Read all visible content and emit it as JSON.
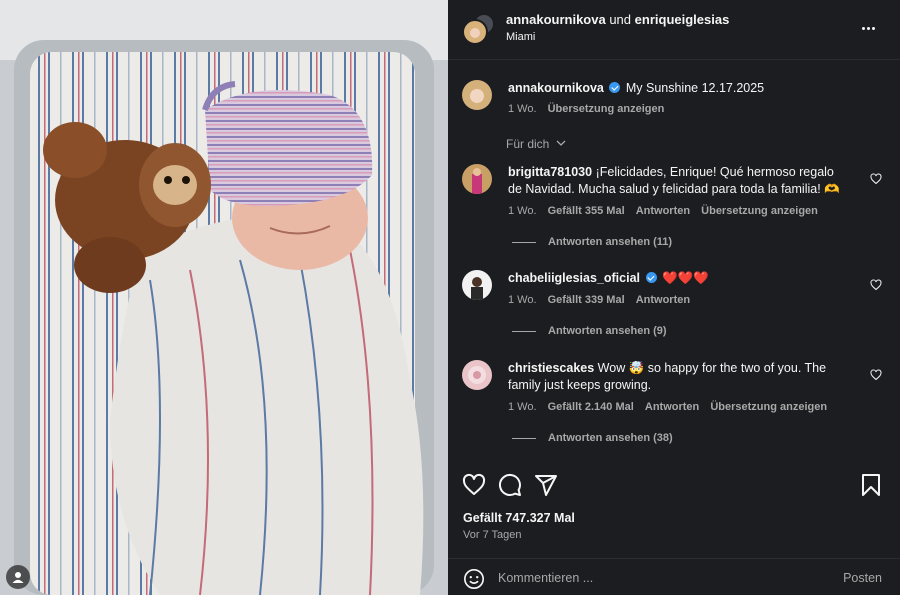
{
  "header": {
    "user1": "annakournikova",
    "conjunction": "und",
    "user2": "enriqueiglesias",
    "location": "Miami"
  },
  "caption": {
    "username": "annakournikova",
    "text": "My Sunshine 12.17.2025",
    "time": "1 Wo.",
    "translate": "Übersetzung anzeigen"
  },
  "filter_label": "Für dich",
  "comments": [
    {
      "username": "brigitta781030",
      "text": "¡Felicidades, Enrique! Qué hermoso regalo de Navidad. Mucha salud y felicidad para toda la familia! 🫶",
      "time": "1 Wo.",
      "likes": "Gefällt 355 Mal",
      "reply": "Antworten",
      "translate": "Übersetzung anzeigen",
      "view_replies": "Antworten ansehen (11)"
    },
    {
      "username": "chabeliiglesias_oficial",
      "text": "❤️❤️❤️",
      "time": "1 Wo.",
      "likes": "Gefällt 339 Mal",
      "reply": "Antworten",
      "view_replies": "Antworten ansehen (9)"
    },
    {
      "username": "christiescakes",
      "text": "Wow 🤯 so happy for the two of you. The family just keeps growing.",
      "time": "1 Wo.",
      "likes": "Gefällt 2.140 Mal",
      "reply": "Antworten",
      "translate": "Übersetzung anzeigen",
      "view_replies": "Antworten ansehen (38)"
    }
  ],
  "post": {
    "likes": "Gefällt 747.327 Mal",
    "date": "Vor 7 Tagen"
  },
  "composer": {
    "placeholder": "Kommentieren ...",
    "post_label": "Posten"
  },
  "colors": {
    "panel_bg": "#1c1d21",
    "text": "#f5f5f5",
    "secondary": "#a8a8a8",
    "verified": "#3897f0",
    "heart": "#e0245e"
  },
  "icons": [
    "more-icon",
    "verified-icon",
    "chevron-down-icon",
    "heart-icon",
    "comment-icon",
    "share-icon",
    "bookmark-icon",
    "emoji-icon",
    "user-tag-icon"
  ]
}
